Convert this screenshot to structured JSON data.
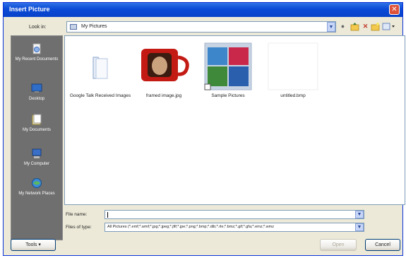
{
  "window": {
    "title": "Insert Picture"
  },
  "lookin": {
    "label": "Look in:",
    "value": "My Pictures"
  },
  "toolbar": {
    "back": "back-arrow-icon",
    "up": "up-folder-icon",
    "delete": "delete-icon",
    "new_folder": "new-folder-icon",
    "views": "views-menu-icon"
  },
  "places": [
    {
      "label": "My Recent Documents",
      "icon": "recent-documents-icon"
    },
    {
      "label": "Desktop",
      "icon": "desktop-icon"
    },
    {
      "label": "My Documents",
      "icon": "my-documents-icon"
    },
    {
      "label": "My Computer",
      "icon": "my-computer-icon"
    },
    {
      "label": "My Network Places",
      "icon": "network-places-icon"
    }
  ],
  "files": [
    {
      "name": "Google Talk Received Images",
      "type": "folder"
    },
    {
      "name": "framed image.jpg",
      "type": "image"
    },
    {
      "name": "Sample Pictures",
      "type": "folder-thumbnails"
    },
    {
      "name": "untitled.bmp",
      "type": "image"
    }
  ],
  "filename": {
    "label": "File name:",
    "value": ""
  },
  "filetype": {
    "label": "Files of type:",
    "value": "All Pictures (*.emf;*.wmf;*.jpg;*.jpeg;*.jfif;*.jpe;*.png;*.bmp;*.dib;*.rle;*.bmz;*.gif;*.gfa;*.emz;*.wmz"
  },
  "buttons": {
    "tools": "Tools",
    "open": "Open",
    "cancel": "Cancel"
  },
  "colors": {
    "titlebar": "#0a4ad6",
    "places_bg": "#6f6f6f",
    "dialog_bg": "#ece9d8"
  }
}
